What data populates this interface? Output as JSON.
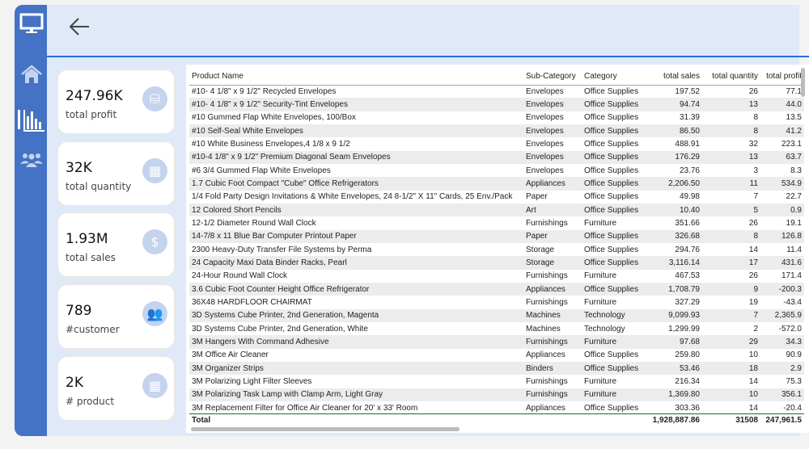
{
  "nav": {
    "items": [
      "monitor",
      "home",
      "reports",
      "customers"
    ]
  },
  "kpis": [
    {
      "value": "247.96K",
      "label": "total profit",
      "icon": "coins-icon"
    },
    {
      "value": "32K",
      "label": "total quantity",
      "icon": "boxes-icon"
    },
    {
      "value": "1.93M",
      "label": "total sales",
      "icon": "dollar-icon"
    },
    {
      "value": "789",
      "label": "#customer",
      "icon": "people-icon"
    },
    {
      "value": "2K",
      "label": "# product",
      "icon": "boxes-icon"
    }
  ],
  "table": {
    "columns": [
      "Product Name",
      "Sub-Category",
      "Category",
      "total sales",
      "total quantity",
      "total profit"
    ],
    "rows": [
      [
        "#10- 4 1/8\" x 9 1/2\" Recycled Envelopes",
        "Envelopes",
        "Office Supplies",
        "197.52",
        "26",
        "77.1"
      ],
      [
        "#10- 4 1/8\" x 9 1/2\" Security-Tint Envelopes",
        "Envelopes",
        "Office Supplies",
        "94.74",
        "13",
        "44.0"
      ],
      [
        "#10 Gummed Flap White Envelopes, 100/Box",
        "Envelopes",
        "Office Supplies",
        "31.39",
        "8",
        "13.5"
      ],
      [
        "#10 Self-Seal White Envelopes",
        "Envelopes",
        "Office Supplies",
        "86.50",
        "8",
        "41.2"
      ],
      [
        "#10 White Business Envelopes,4 1/8 x 9 1/2",
        "Envelopes",
        "Office Supplies",
        "488.91",
        "32",
        "223.1"
      ],
      [
        "#10-4 1/8\" x 9 1/2\" Premium Diagonal Seam Envelopes",
        "Envelopes",
        "Office Supplies",
        "176.29",
        "13",
        "63.7"
      ],
      [
        "#6 3/4 Gummed Flap White Envelopes",
        "Envelopes",
        "Office Supplies",
        "23.76",
        "3",
        "8.3"
      ],
      [
        "1.7 Cubic Foot Compact \"Cube\" Office Refrigerators",
        "Appliances",
        "Office Supplies",
        "2,206.50",
        "11",
        "534.9"
      ],
      [
        "1/4 Fold Party Design Invitations & White Envelopes, 24 8-1/2\" X 11\" Cards, 25 Env./Pack",
        "Paper",
        "Office Supplies",
        "49.98",
        "7",
        "22.7"
      ],
      [
        "12 Colored Short Pencils",
        "Art",
        "Office Supplies",
        "10.40",
        "5",
        "0.9"
      ],
      [
        "12-1/2 Diameter Round Wall Clock",
        "Furnishings",
        "Furniture",
        "351.66",
        "26",
        "19.1"
      ],
      [
        "14-7/8 x 11 Blue Bar Computer Printout Paper",
        "Paper",
        "Office Supplies",
        "326.68",
        "8",
        "126.8"
      ],
      [
        "2300 Heavy-Duty Transfer File Systems by Perma",
        "Storage",
        "Office Supplies",
        "294.76",
        "14",
        "11.4"
      ],
      [
        "24 Capacity Maxi Data Binder Racks, Pearl",
        "Storage",
        "Office Supplies",
        "3,116.14",
        "17",
        "431.6"
      ],
      [
        "24-Hour Round Wall Clock",
        "Furnishings",
        "Furniture",
        "467.53",
        "26",
        "171.4"
      ],
      [
        "3.6 Cubic Foot Counter Height Office Refrigerator",
        "Appliances",
        "Office Supplies",
        "1,708.79",
        "9",
        "-200.3"
      ],
      [
        "36X48 HARDFLOOR CHAIRMAT",
        "Furnishings",
        "Furniture",
        "327.29",
        "19",
        "-43.4"
      ],
      [
        "3D Systems Cube Printer, 2nd Generation, Magenta",
        "Machines",
        "Technology",
        "9,099.93",
        "7",
        "2,365.9"
      ],
      [
        "3D Systems Cube Printer, 2nd Generation, White",
        "Machines",
        "Technology",
        "1,299.99",
        "2",
        "-572.0"
      ],
      [
        "3M Hangers With Command Adhesive",
        "Furnishings",
        "Furniture",
        "97.68",
        "29",
        "34.3"
      ],
      [
        "3M Office Air Cleaner",
        "Appliances",
        "Office Supplies",
        "259.80",
        "10",
        "90.9"
      ],
      [
        "3M Organizer Strips",
        "Binders",
        "Office Supplies",
        "53.46",
        "18",
        "2.9"
      ],
      [
        "3M Polarizing Light Filter Sleeves",
        "Furnishings",
        "Furniture",
        "216.34",
        "14",
        "75.3"
      ],
      [
        "3M Polarizing Task Lamp with Clamp Arm, Light Gray",
        "Furnishings",
        "Furniture",
        "1,369.80",
        "10",
        "356.1"
      ],
      [
        "3M Replacement Filter for Office Air Cleaner for 20' x 33' Room",
        "Appliances",
        "Office Supplies",
        "303.36",
        "14",
        "-20.4"
      ]
    ],
    "total": [
      "Total",
      "",
      "",
      "1,928,887.86",
      "31508",
      "247,961.5"
    ]
  }
}
